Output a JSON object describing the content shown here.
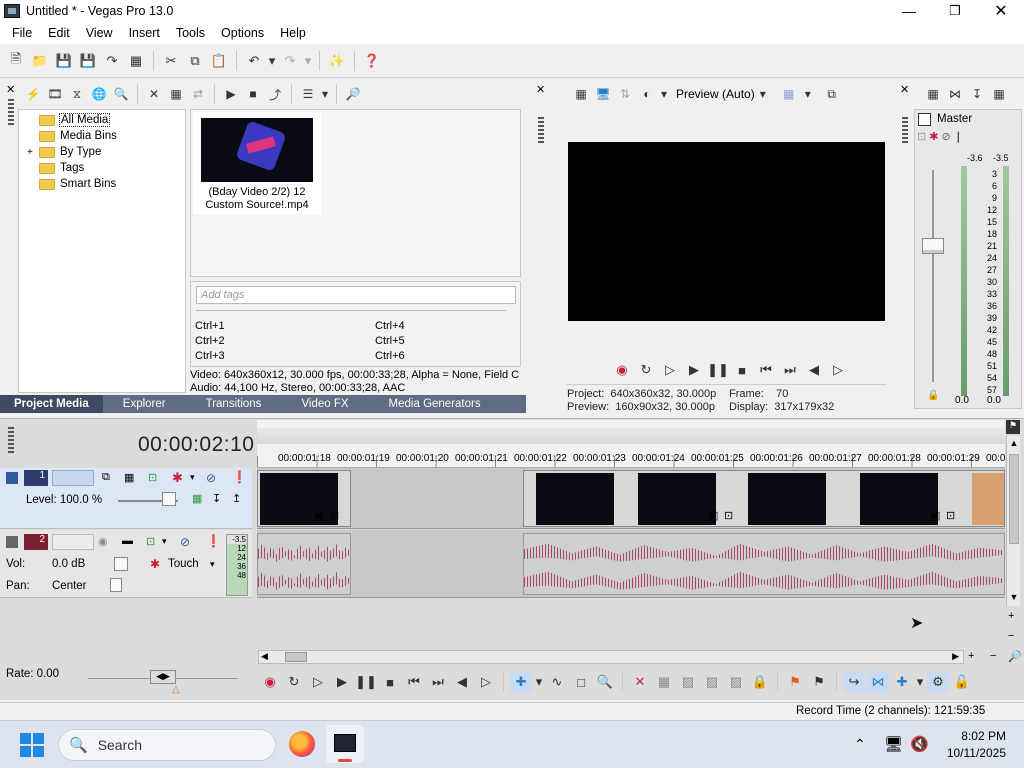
{
  "window": {
    "title": "Untitled * - Vegas Pro 13.0"
  },
  "menu": [
    "File",
    "Edit",
    "View",
    "Insert",
    "Tools",
    "Options",
    "Help"
  ],
  "project_media": {
    "tree": [
      {
        "label": "All Media",
        "selected": true
      },
      {
        "label": "Media Bins"
      },
      {
        "label": "By Type",
        "expandable": true
      },
      {
        "label": "Tags"
      },
      {
        "label": "Smart Bins"
      }
    ],
    "media_item": {
      "line1": "(Bday Video 2/2) 12",
      "line2": "Custom Source!.mp4"
    },
    "tags_placeholder": "Add tags",
    "shortcuts": [
      "Ctrl+1",
      "Ctrl+4",
      "Ctrl+2",
      "Ctrl+5",
      "Ctrl+3",
      "Ctrl+6"
    ],
    "info_video": "Video: 640x360x12, 30.000 fps, 00:00:33;28, Alpha = None, Field C",
    "info_audio": "Audio: 44,100 Hz, Stereo, 00:00:33;28, AAC"
  },
  "tabs": [
    {
      "label": "Project Media",
      "active": true
    },
    {
      "label": "Explorer"
    },
    {
      "label": "Transitions"
    },
    {
      "label": "Video FX"
    },
    {
      "label": "Media Generators"
    }
  ],
  "preview": {
    "mode": "Preview (Auto)",
    "project_label": "Project:",
    "project_value": "640x360x32, 30.000p",
    "frame_label": "Frame:",
    "frame_value": "70",
    "preview_label": "Preview:",
    "preview_value": "160x90x32, 30.000p",
    "display_label": "Display:",
    "display_value": "317x179x32"
  },
  "master": {
    "label": "Master",
    "peak_left": "-3.6",
    "peak_right": "-3.5",
    "scale": [
      "3",
      "6",
      "9",
      "12",
      "15",
      "18",
      "21",
      "24",
      "27",
      "30",
      "33",
      "36",
      "39",
      "42",
      "45",
      "48",
      "51",
      "54",
      "57"
    ],
    "bottom_left": "0.0",
    "bottom_right": "0.0"
  },
  "timeline": {
    "time": "00:00:02:10",
    "ruler": [
      "00:00:01:18",
      "00:00:01:19",
      "00:00:01:20",
      "00:00:01:21",
      "00:00:01:22",
      "00:00:01:23",
      "00:00:01:24",
      "00:00:01:25",
      "00:00:01:26",
      "00:00:01:27",
      "00:00:01:28",
      "00:00:01:29",
      "00:00:0"
    ],
    "video_track": {
      "number": "1",
      "level": "Level: 100.0 %"
    },
    "audio_track": {
      "number": "2",
      "vol_label": "Vol:",
      "vol_value": "0.0 dB",
      "pan_label": "Pan:",
      "pan_value": "Center",
      "mode": "Touch",
      "meter_top": "-3.5",
      "meter_scale": [
        "12",
        "24",
        "36",
        "48"
      ]
    },
    "rate": "Rate: 0.00",
    "record_time": "Record Time (2 channels): 121:59:35"
  },
  "taskbar": {
    "search": "Search",
    "time": "8:02 PM",
    "date": "10/11/2025"
  },
  "colors": {
    "tabs_bg": "#5f6c82",
    "audio_wave": "#a23050",
    "taskbar_bg": "#dde4ee"
  }
}
